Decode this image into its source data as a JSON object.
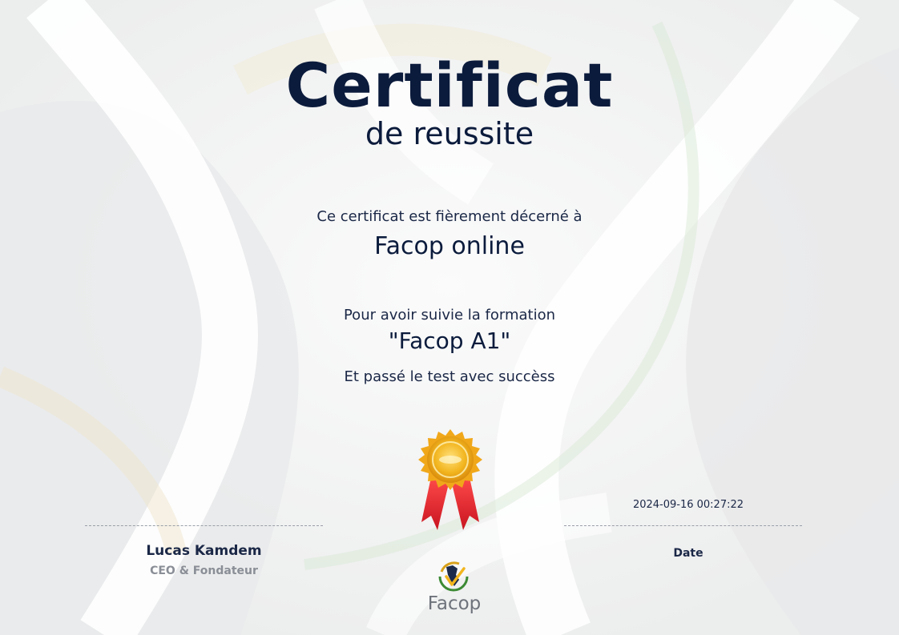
{
  "certificate": {
    "title": "Certificat",
    "subtitle": "de reussite",
    "awarded_label": "Ce certificat est fièrement décerné à",
    "recipient": "Facop online",
    "training_label": "Pour avoir suivie la formation",
    "training_name": "\"Facop A1\"",
    "test_label": "Et passé le test avec succèss"
  },
  "signature": {
    "name": "Lucas Kamdem",
    "role": "CEO & Fondateur"
  },
  "date": {
    "value": "2024-09-16 00:27:22",
    "label": "Date"
  },
  "brand": {
    "name": "Facop"
  },
  "icons": {
    "medal": "award-medal-icon",
    "logo": "facop-logo-icon"
  },
  "colors": {
    "navy": "#0b1b3c",
    "gold": "#f2b51e",
    "ribbon_red": "#e0202a",
    "logo_green": "#3c8a34"
  }
}
